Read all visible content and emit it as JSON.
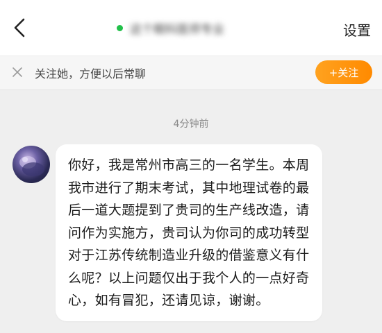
{
  "header": {
    "back_icon": "chevron-left-icon",
    "contact_name": "这个眼科医师专业",
    "online_color": "#22c04a",
    "settings_label": "设置"
  },
  "follow_banner": {
    "close_icon": "close-icon",
    "text": "关注她，方便以后常聊",
    "button_label": "+关注",
    "button_color": "#ff9500"
  },
  "chat": {
    "timestamp": "4分钟前",
    "messages": [
      {
        "sender": "other",
        "text": "你好，我是常州市高三的一名学生。本周我市进行了期末考试，其中地理试卷的最后一道大题提到了贵司的生产线改造，请问作为实施方，贵司认为你司的成功转型对于江苏传统制造业升级的借鉴意义有什么呢？以上问题仅出于我个人的一点好奇心，如有冒犯，还请见谅，谢谢。"
      }
    ]
  }
}
